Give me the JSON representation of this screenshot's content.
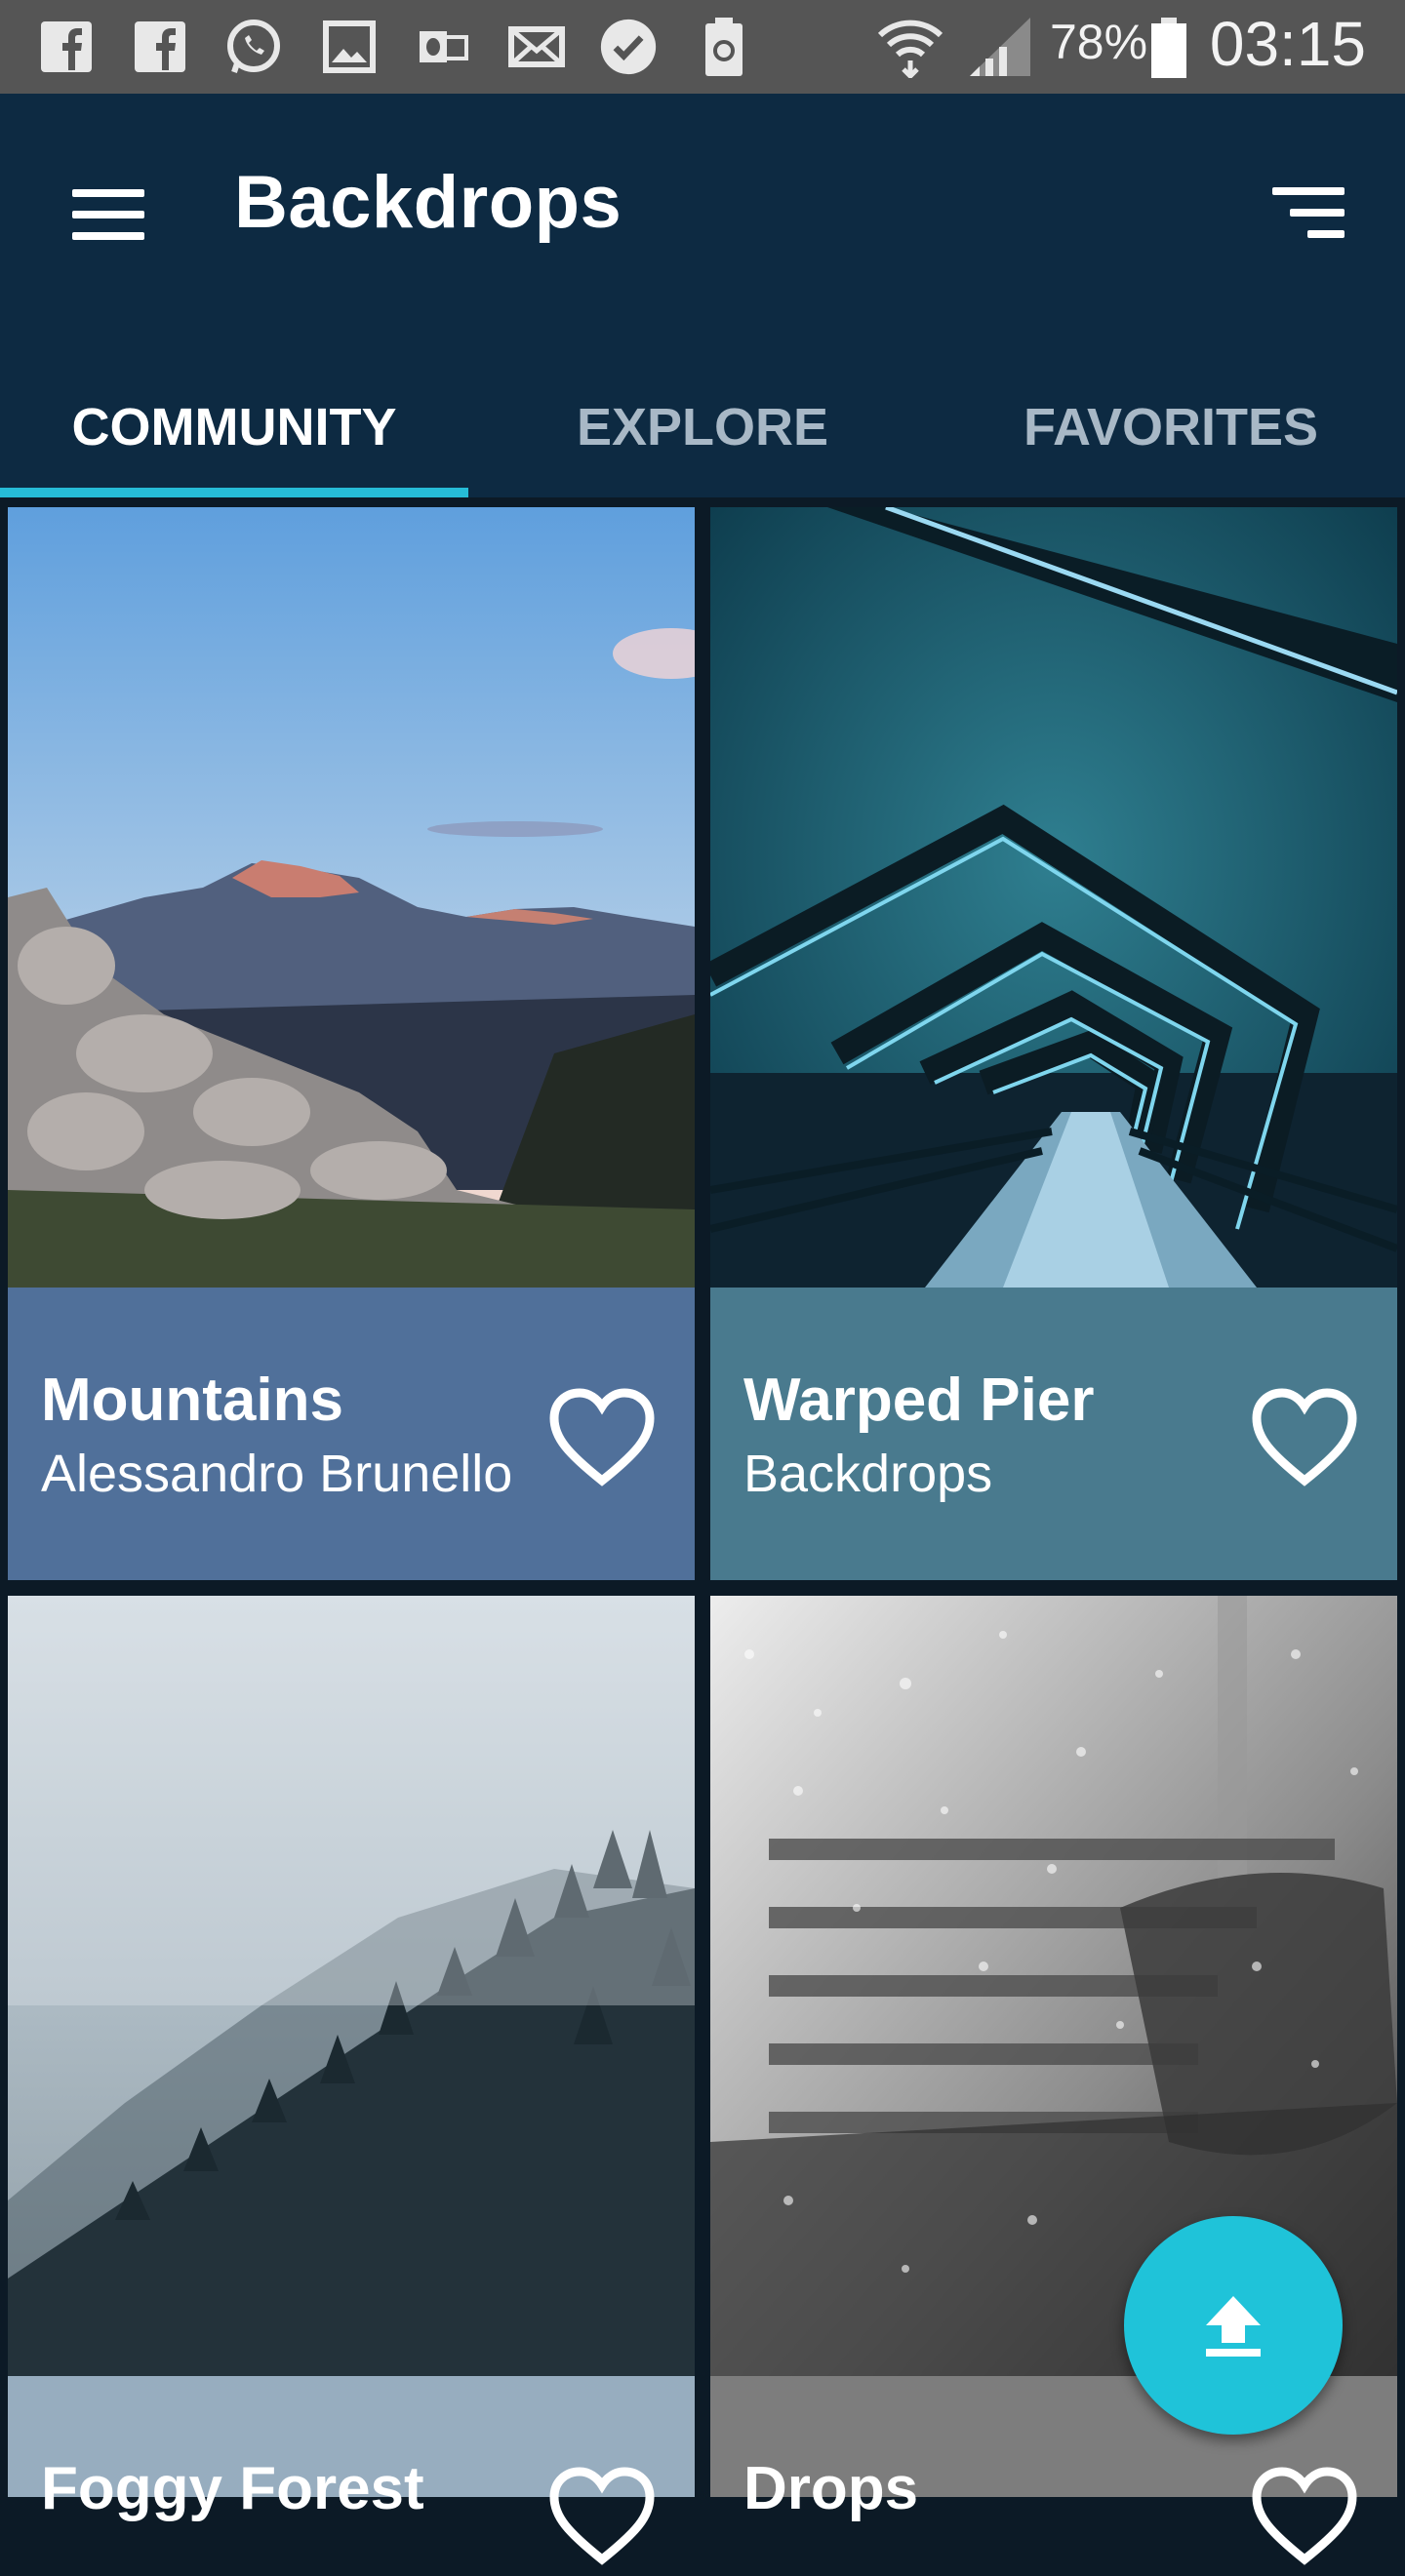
{
  "status_bar": {
    "battery": "78%",
    "time": "03:15",
    "icons": [
      "facebook-icon",
      "facebook-icon",
      "whatsapp-icon",
      "gallery-icon",
      "outlook-icon",
      "mail-icon",
      "check-icon",
      "battery-saver-icon",
      "wifi-icon",
      "signal-icon",
      "battery-icon"
    ]
  },
  "app_bar": {
    "title": "Backdrops",
    "menu_icon": "hamburger-menu-icon",
    "sort_icon": "sort-icon"
  },
  "tabs": [
    {
      "label": "COMMUNITY",
      "active": true
    },
    {
      "label": "EXPLORE",
      "active": false
    },
    {
      "label": "FAVORITES",
      "active": false
    }
  ],
  "wallpapers": [
    {
      "title": "Mountains",
      "author": "Alessandro Brunello",
      "caption_color": "#50709a"
    },
    {
      "title": "Warped Pier",
      "author": "Backdrops",
      "caption_color": "#497a8e"
    },
    {
      "title": "Foggy Forest",
      "author": "",
      "caption_color": "#97adbf"
    },
    {
      "title": "Drops",
      "author": "",
      "caption_color": "#7d7d7d"
    }
  ],
  "fab": {
    "icon": "upload-icon"
  },
  "colors": {
    "app_bar": "#0d2a42",
    "accent": "#26bcd7",
    "background": "#0c1a26"
  }
}
